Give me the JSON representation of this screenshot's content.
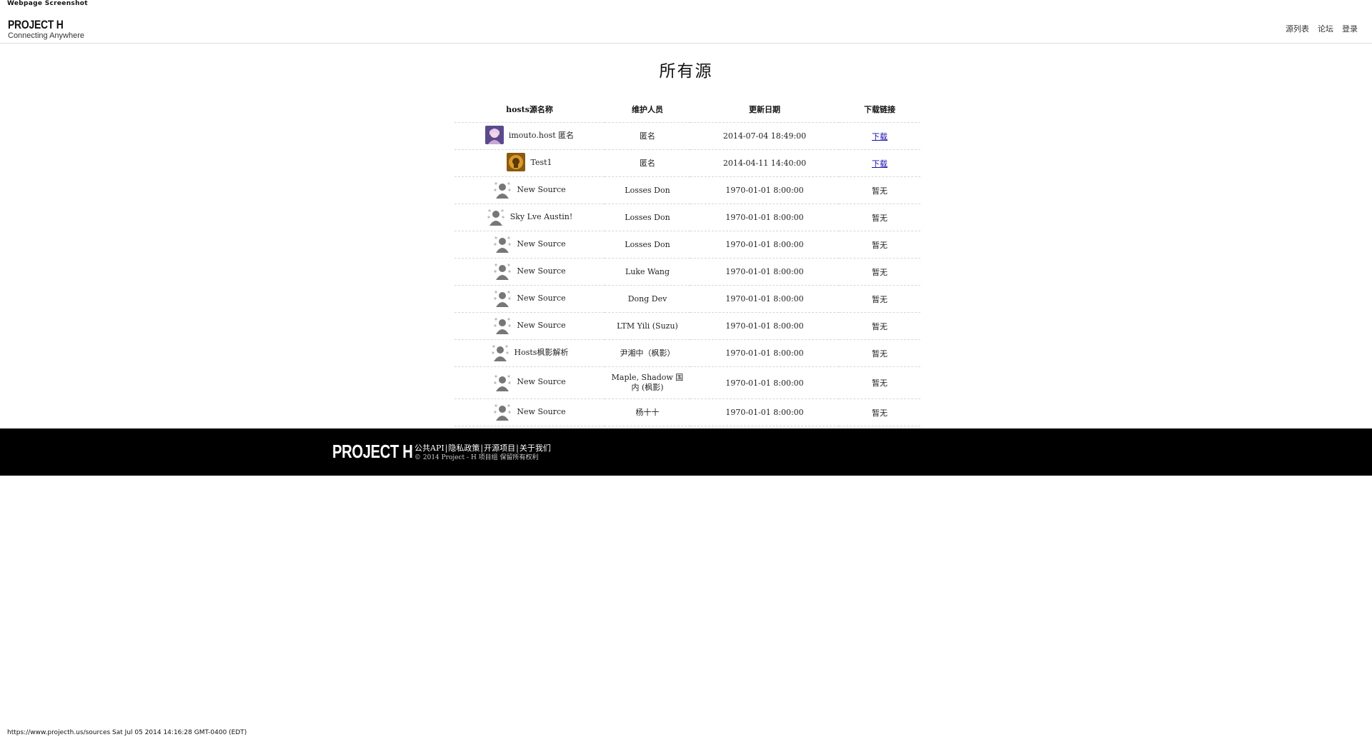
{
  "print": {
    "header": "Webpage Screenshot",
    "footer": "https://www.projecth.us/sources Sat Jul 05 2014 14:16:28 GMT-0400 (EDT)"
  },
  "nav": {
    "brand_title": "PROJECT H",
    "brand_subtitle": "Connecting Anywhere",
    "links": [
      "源列表",
      "论坛",
      "登录"
    ]
  },
  "page_title": "所有源",
  "table": {
    "headers": [
      "hosts源名称",
      "维护人员",
      "更新日期",
      "下载链接"
    ],
    "rows": [
      {
        "avatar": "anime-avatar-icon",
        "name": "imouto.host 匿名",
        "maintainer": "匿名",
        "date": "2014-07-04 18:49:00",
        "download": "下载",
        "download_is_link": true
      },
      {
        "avatar": "gold-avatar-icon",
        "name": "Test1",
        "maintainer": "匿名",
        "date": "2014-04-11 14:40:00",
        "download": "下载",
        "download_is_link": true
      },
      {
        "avatar": "default-user-icon",
        "name": "New Source",
        "maintainer": "Losses Don",
        "date": "1970-01-01 8:00:00",
        "download": "暂无",
        "download_is_link": false
      },
      {
        "avatar": "default-user-icon",
        "name": "Sky Lve Austin!",
        "maintainer": "Losses Don",
        "date": "1970-01-01 8:00:00",
        "download": "暂无",
        "download_is_link": false
      },
      {
        "avatar": "default-user-icon",
        "name": "New Source",
        "maintainer": "Losses Don",
        "date": "1970-01-01 8:00:00",
        "download": "暂无",
        "download_is_link": false
      },
      {
        "avatar": "default-user-icon",
        "name": "New Source",
        "maintainer": "Luke Wang",
        "date": "1970-01-01 8:00:00",
        "download": "暂无",
        "download_is_link": false
      },
      {
        "avatar": "default-user-icon",
        "name": "New Source",
        "maintainer": "Dong Dev",
        "date": "1970-01-01 8:00:00",
        "download": "暂无",
        "download_is_link": false
      },
      {
        "avatar": "default-user-icon",
        "name": "New Source",
        "maintainer": "LTM Yili (Suzu)",
        "date": "1970-01-01 8:00:00",
        "download": "暂无",
        "download_is_link": false
      },
      {
        "avatar": "default-user-icon",
        "name": "Hosts枫影解析",
        "maintainer": "尹湘中（枫影）",
        "date": "1970-01-01 8:00:00",
        "download": "暂无",
        "download_is_link": false
      },
      {
        "avatar": "default-user-icon",
        "name": "New Source",
        "maintainer": "Maple, Shadow 国内 (枫影)",
        "date": "1970-01-01 8:00:00",
        "download": "暂无",
        "download_is_link": false
      },
      {
        "avatar": "default-user-icon",
        "name": "New Source",
        "maintainer": "杨十十",
        "date": "1970-01-01 8:00:00",
        "download": "暂无",
        "download_is_link": false
      }
    ]
  },
  "footer": {
    "logo": "PROJECT H",
    "links": [
      "公共API",
      "隐私政策",
      "开源项目",
      "关于我们"
    ],
    "copyright": "© 2014 Project - H 项目组 保留所有权利"
  },
  "colors": {
    "link": "#1a0dab",
    "footer_bg": "#000000",
    "divider": "#d7d7d7"
  }
}
